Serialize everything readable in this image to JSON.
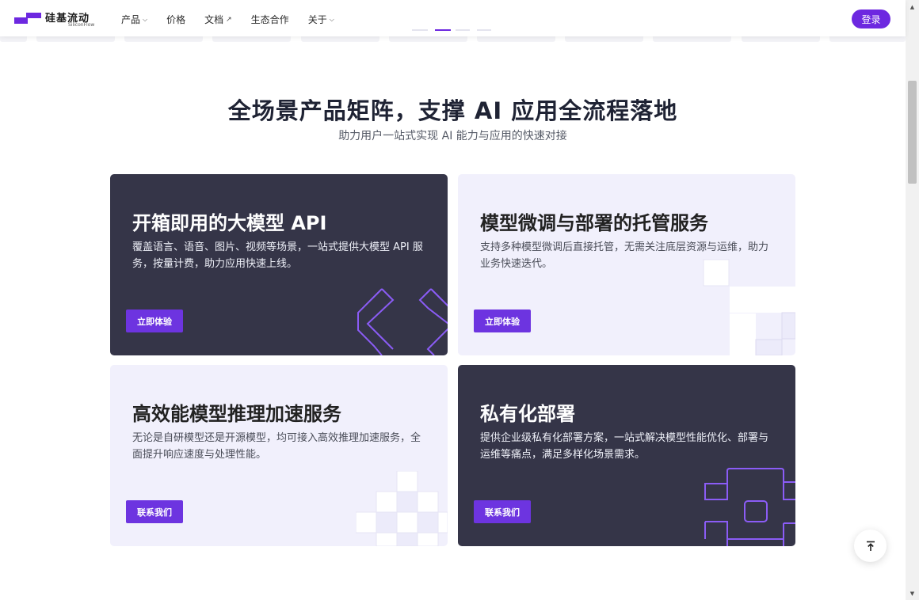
{
  "header": {
    "logo_cn": "硅基流动",
    "logo_en": "SiliconFlow",
    "nav": [
      {
        "label": "产品",
        "icon": "chevron-down-icon"
      },
      {
        "label": "价格"
      },
      {
        "label": "文档",
        "icon": "external-arrow-icon"
      },
      {
        "label": "生态合作"
      },
      {
        "label": "关于",
        "icon": "chevron-down-icon"
      }
    ],
    "login": "登录"
  },
  "section": {
    "title": "全场景产品矩阵，支撑 AI 应用全流程落地",
    "subtitle": "助力用户一站式实现 AI 能力与应用的快速对接"
  },
  "cards": [
    {
      "title": "开箱即用的大模型 API",
      "desc": "覆盖语言、语音、图片、视频等场景，一站式提供大模型 API 服务，按量计费，助力应用快速上线。",
      "button": "立即体验",
      "theme": "dark"
    },
    {
      "title": "模型微调与部署的托管服务",
      "desc": "支持多种模型微调后直接托管，无需关注底层资源与运维，助力业务快速迭代。",
      "button": "立即体验",
      "theme": "light"
    },
    {
      "title": "高效能模型推理加速服务",
      "desc": "无论是自研模型还是开源模型，均可接入高效推理加速服务，全面提升响应速度与处理性能。",
      "button": "联系我们",
      "theme": "light"
    },
    {
      "title": "私有化部署",
      "desc": "提供企业级私有化部署方案，一站式解决模型性能优化、部署与运维等痛点，满足多样化场景需求。",
      "button": "联系我们",
      "theme": "dark"
    }
  ],
  "colors": {
    "accent": "#6d28e0",
    "card_dark": "#353548",
    "card_light": "#f1f0fc",
    "deco_line": "#8b5cf6"
  },
  "icons": {
    "back_to_top": "arrow-to-top-icon",
    "scroll_up": "scroll-up-arrow-icon",
    "scroll_down": "scroll-down-arrow-icon"
  }
}
